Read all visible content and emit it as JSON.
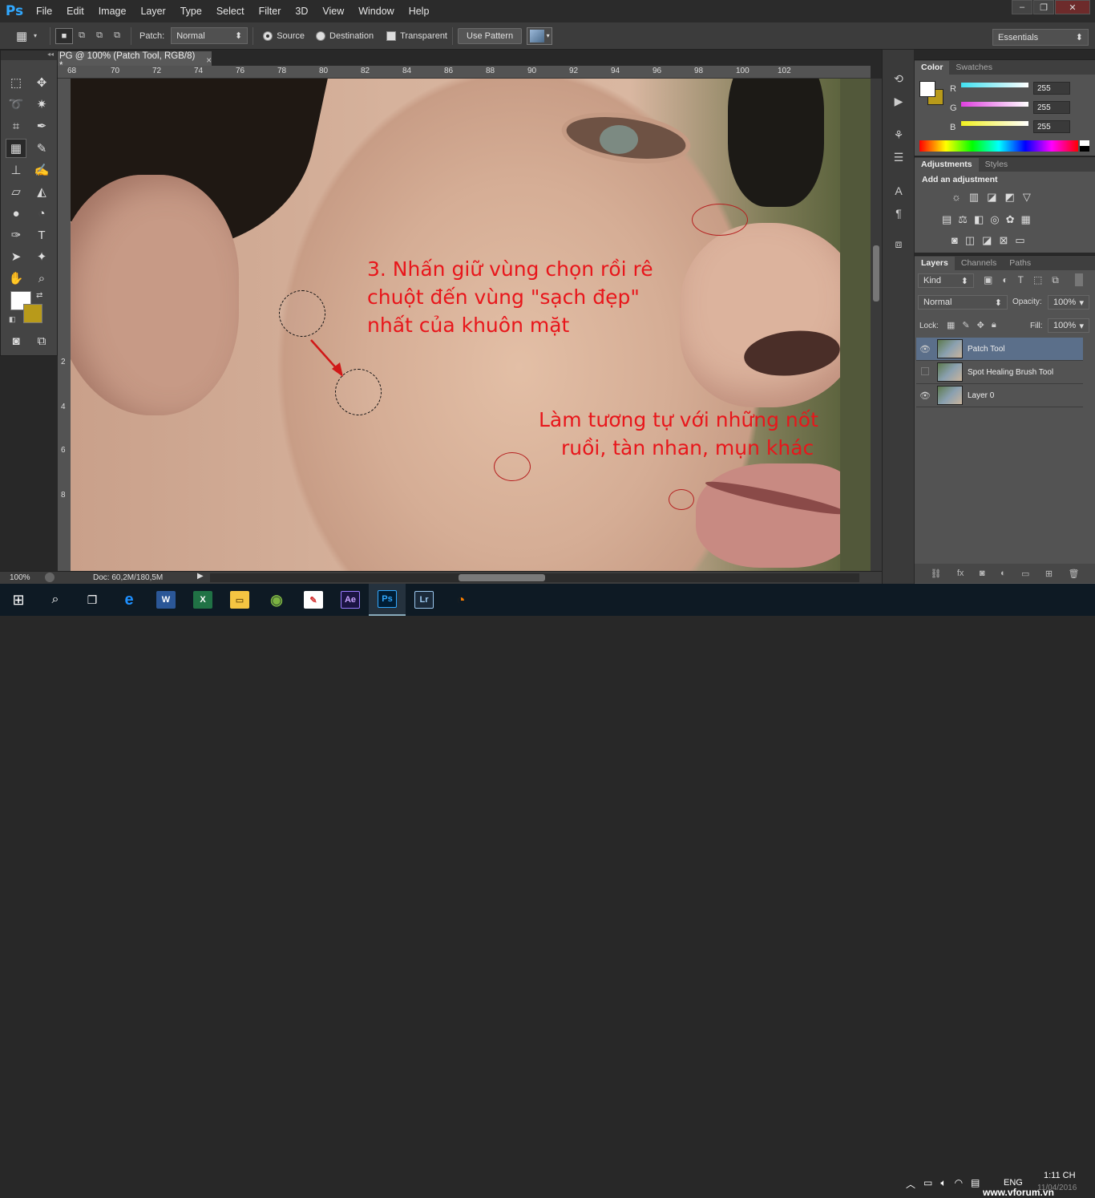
{
  "app": {
    "logo": "Ps"
  },
  "menu": [
    "File",
    "Edit",
    "Image",
    "Layer",
    "Type",
    "Select",
    "Filter",
    "3D",
    "View",
    "Window",
    "Help"
  ],
  "window_controls": {
    "minimize": "–",
    "restore": "❐",
    "close": "✕"
  },
  "options_bar": {
    "patch_label": "Patch:",
    "patch_mode": "Normal",
    "source_label": "Source",
    "destination_label": "Destination",
    "transparent_label": "Transparent",
    "use_pattern_label": "Use Pattern",
    "workspace": "Essentials"
  },
  "document": {
    "tab_title": "PG @ 100% (Patch Tool, RGB/8) *",
    "close": "×",
    "ruler_numbers": [
      "68",
      "70",
      "72",
      "74",
      "76",
      "78",
      "80",
      "82",
      "84",
      "86",
      "88",
      "90",
      "92",
      "94",
      "96",
      "98",
      "100",
      "102"
    ],
    "ruler_v_numbers": [
      "2",
      "4",
      "6",
      "8"
    ]
  },
  "annotations": {
    "step3_line1": "3. Nhấn giữ vùng chọn rồi rê",
    "step3_line2": "chuột đến vùng \"sạch đẹp\"",
    "step3_line3": "nhất của khuôn mặt",
    "similar_line1": "Làm tương tự với những nốt",
    "similar_line2": "ruồi, tàn nhan, mụn khác"
  },
  "status_bar": {
    "zoom": "100%",
    "doc": "Doc: 60,2M/180,5M"
  },
  "color_panel": {
    "tabs": [
      "Color",
      "Swatches"
    ],
    "channels": [
      {
        "label": "R",
        "value": "255",
        "color": "#40e0f0"
      },
      {
        "label": "G",
        "value": "255",
        "color": "#e040e0"
      },
      {
        "label": "B",
        "value": "255",
        "color": "#f0f020"
      }
    ]
  },
  "adjustments_panel": {
    "tabs": [
      "Adjustments",
      "Styles"
    ],
    "heading": "Add an adjustment"
  },
  "layers_panel": {
    "tabs": [
      "Layers",
      "Channels",
      "Paths"
    ],
    "filter_kind": "Kind",
    "blend_mode": "Normal",
    "opacity_label": "Opacity:",
    "opacity_value": "100%",
    "lock_label": "Lock:",
    "fill_label": "Fill:",
    "fill_value": "100%",
    "layers": [
      {
        "name": "Patch Tool",
        "visible": true,
        "selected": true
      },
      {
        "name": "Spot Healing Brush Tool",
        "visible": false,
        "selected": false
      },
      {
        "name": "Layer 0",
        "visible": true,
        "selected": false
      }
    ]
  },
  "taskbar": {
    "apps": [
      {
        "name": "edge",
        "label": "e",
        "color": "#1e90ff"
      },
      {
        "name": "word",
        "label": "W",
        "color": "#2b5797"
      },
      {
        "name": "excel",
        "label": "X",
        "color": "#207245"
      },
      {
        "name": "explorer",
        "label": "▭",
        "color": "#f4c542"
      },
      {
        "name": "coccoc",
        "label": "◉",
        "color": "#7cb342"
      },
      {
        "name": "foxit",
        "label": "✎",
        "color": "#d32f2f"
      },
      {
        "name": "after-effects",
        "label": "Ae",
        "color": "#1a1442"
      },
      {
        "name": "photoshop",
        "label": "Ps",
        "color": "#001d34"
      },
      {
        "name": "lightroom",
        "label": "Lr",
        "color": "#1b2a3a"
      },
      {
        "name": "other",
        "label": "◔",
        "color": "#f57c00"
      }
    ],
    "language": "ENG",
    "time": "1:11 CH",
    "date": "11/04/2016",
    "watermark": "www.vforum.vn"
  }
}
